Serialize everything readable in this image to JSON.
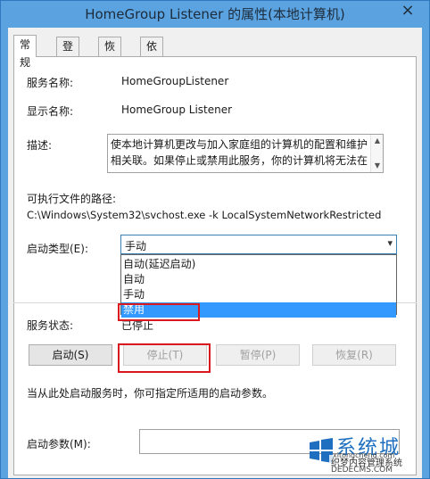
{
  "window": {
    "title": "HomeGroup Listener 的属性(本地计算机)",
    "close_glyph": "×"
  },
  "tabs": [
    {
      "label": "常规",
      "active": true
    },
    {
      "label": "登录",
      "active": false
    },
    {
      "label": "恢复",
      "active": false
    },
    {
      "label": "依存关系",
      "active": false
    }
  ],
  "general": {
    "service_name_label": "服务名称:",
    "service_name_value": "HomeGroupListener",
    "display_name_label": "显示名称:",
    "display_name_value": "HomeGroup Listener",
    "description_label": "描述:",
    "description_text": "使本地计算机更改与加入家庭组的计算机的配置和维护相关联。如果停止或禁用此服务，你的计算机将无法在",
    "exe_path_label": "可执行文件的路径:",
    "exe_path_value": "C:\\Windows\\System32\\svchost.exe -k LocalSystemNetworkRestricted",
    "startup_type_label": "启动类型(E):",
    "startup_type_value": "手动",
    "startup_options": [
      {
        "label": "自动(延迟启动)",
        "selected": false
      },
      {
        "label": "自动",
        "selected": false
      },
      {
        "label": "手动",
        "selected": false
      },
      {
        "label": "禁用",
        "selected": true
      }
    ],
    "service_status_label": "服务状态:",
    "service_status_value": "已停止",
    "buttons": {
      "start": "启动(S)",
      "stop": "停止(T)",
      "pause": "暂停(P)",
      "resume": "恢复(R)"
    },
    "hint": "当从此处启动服务时，你可指定所适用的启动参数。",
    "start_params_label": "启动参数(M):",
    "start_params_value": ""
  },
  "watermark": {
    "line1": "系统城",
    "line2": "织梦内容管理系统",
    "line3": "DEDECMS.COM",
    "line4": "xitongcheng.com"
  }
}
